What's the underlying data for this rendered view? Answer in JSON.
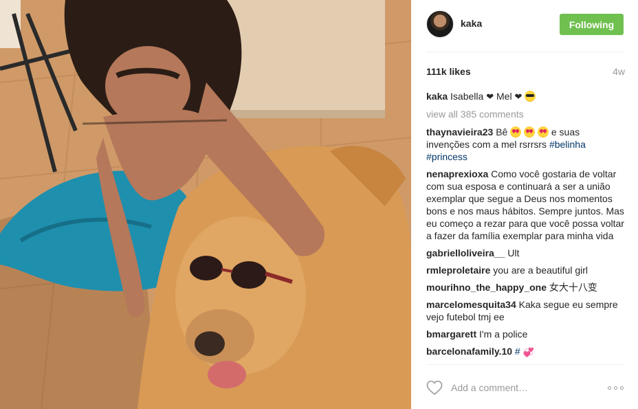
{
  "header": {
    "username": "kaka",
    "follow_label": "Following",
    "follow_color": "#70c050"
  },
  "stats": {
    "likes": "111k likes",
    "time": "4w"
  },
  "caption": {
    "author": "kaka",
    "text": "Isabella",
    "text2": "Mel",
    "icons": [
      "heart-emoji",
      "heart-emoji",
      "sunglasses-emoji"
    ]
  },
  "view_all": "view all 385 comments",
  "comments": [
    {
      "author": "thaynavieira23",
      "pre": "Bê",
      "post": "e suas invenções com a mel rsrrsrs",
      "tags": [
        "#belinha",
        "#princess"
      ]
    },
    {
      "author": "nenaprexioxa",
      "text": "Como você gostaria de voltar com sua esposa e continuará a ser a união exemplar que segue a Deus nos momentos bons e nos maus hábitos. Sempre juntos. Mas eu começo a rezar para que você possa voltar a fazer da família exemplar para minha vida"
    },
    {
      "author": "gabrielloliveira__",
      "text": "Ult"
    },
    {
      "author": "rmleproletaire",
      "text": "you are a beautiful girl"
    },
    {
      "author": "mourihno_the_happy_one",
      "text": "女大十八变"
    },
    {
      "author": "marcelomesquita34",
      "text": "Kaka segue eu sempre vejo futebol tmj ee"
    },
    {
      "author": "bmargarett",
      "text": "I'm a police"
    },
    {
      "author": "barcelonafamily.10",
      "tag": "#"
    }
  ],
  "footer": {
    "comment_placeholder": "Add a comment…"
  },
  "icons": {
    "like": "heart-outline-icon",
    "more": "more-options-icon"
  }
}
